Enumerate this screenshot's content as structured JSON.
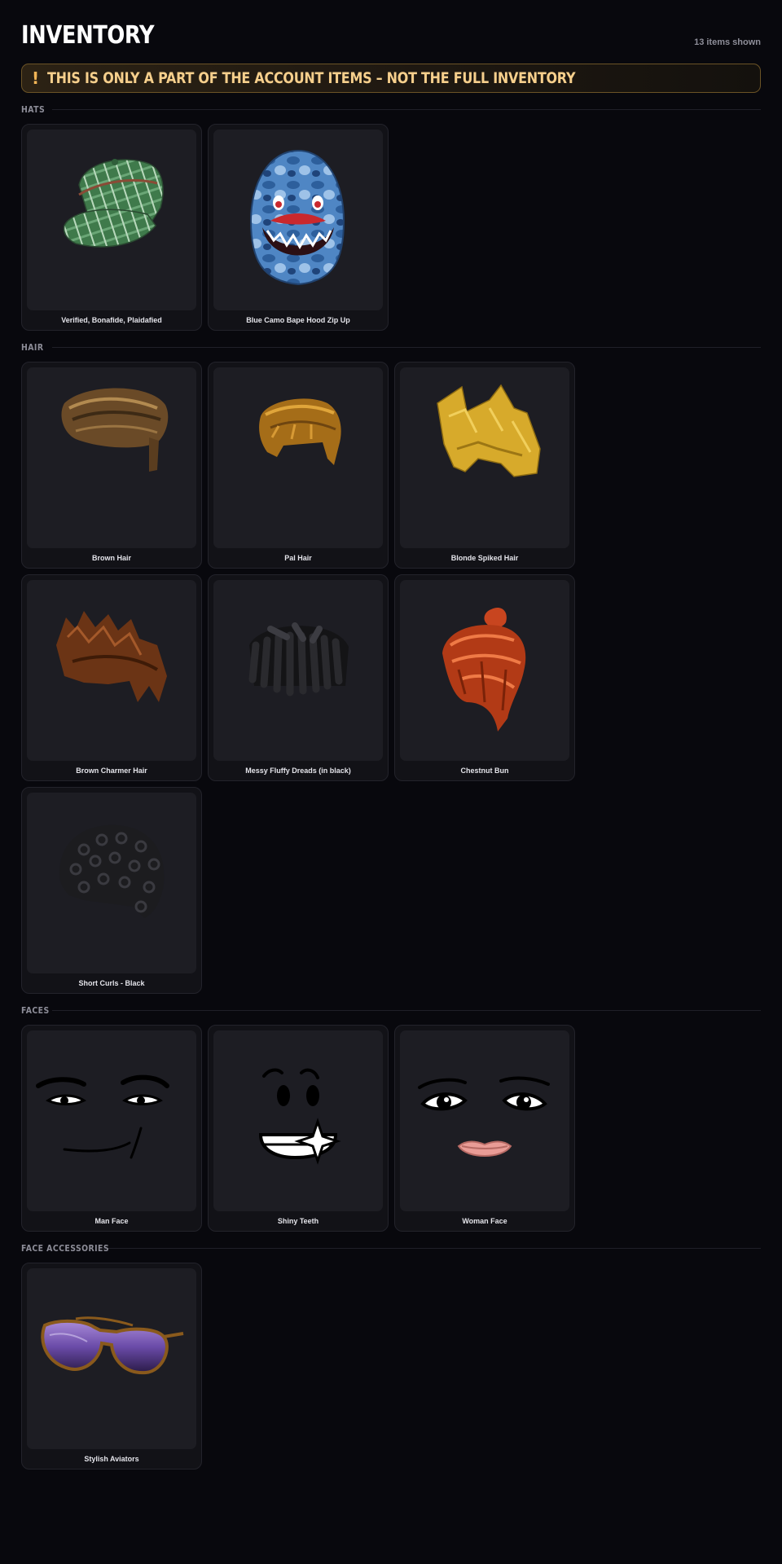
{
  "header": {
    "title": "INVENTORY",
    "count": "13 items shown"
  },
  "warning": {
    "icon": "!",
    "text": "THIS IS ONLY A PART OF THE ACCOUNT ITEMS – NOT THE FULL INVENTORY"
  },
  "sections": [
    {
      "title": "HATS",
      "items": [
        {
          "name": "Verified, Bonafide, Plaidafied",
          "icon": "green-plaid-cap-image"
        },
        {
          "name": "Blue Camo Bape Hood Zip Up",
          "icon": "blue-camo-hood-image"
        }
      ]
    },
    {
      "title": "HAIR",
      "items": [
        {
          "name": "Brown Hair",
          "icon": "brown-hair-image"
        },
        {
          "name": "Pal Hair",
          "icon": "pal-hair-image"
        },
        {
          "name": "Blonde Spiked Hair",
          "icon": "blonde-spiked-hair-image"
        },
        {
          "name": "Brown Charmer Hair",
          "icon": "brown-charmer-hair-image"
        },
        {
          "name": "Messy Fluffy Dreads (in black)",
          "icon": "black-dreads-image"
        },
        {
          "name": "Chestnut Bun",
          "icon": "chestnut-bun-image"
        },
        {
          "name": "Short Curls - Black",
          "icon": "black-curls-image"
        }
      ]
    },
    {
      "title": "FACES",
      "items": [
        {
          "name": "Man Face",
          "icon": "man-face-image"
        },
        {
          "name": "Shiny Teeth",
          "icon": "shiny-teeth-face-image"
        },
        {
          "name": "Woman Face",
          "icon": "woman-face-image"
        }
      ]
    },
    {
      "title": "FACE ACCESSORIES",
      "items": [
        {
          "name": "Stylish Aviators",
          "icon": "aviator-sunglasses-image"
        }
      ]
    }
  ],
  "colors": {
    "background": "#08080d",
    "accent": "#f2b556",
    "card": "#121217"
  }
}
